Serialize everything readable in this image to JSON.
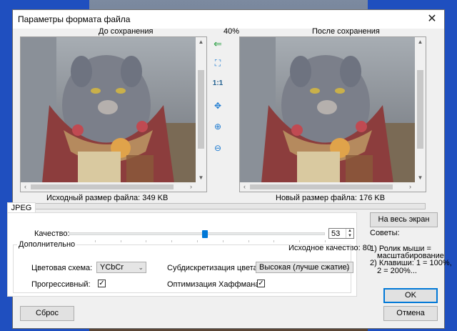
{
  "window": {
    "title": "Параметры формата файла",
    "close_glyph": "✕"
  },
  "zoom_label": "40%",
  "panes": {
    "before_caption": "До сохранения",
    "after_caption": "После сохранения"
  },
  "sizes": {
    "original": "Исходный размер файла:  349 KB",
    "new": "Новый размер файла:  176 KB"
  },
  "toolbar": [
    {
      "name": "back-arrow-icon",
      "glyph": "⇐"
    },
    {
      "name": "fit-window-icon",
      "glyph": "⛶"
    },
    {
      "name": "actual-size-icon",
      "glyph": "1:1"
    },
    {
      "name": "center-icon",
      "glyph": "✥"
    },
    {
      "name": "zoom-in-icon",
      "glyph": "⊕"
    },
    {
      "name": "zoom-out-icon",
      "glyph": "⊖"
    }
  ],
  "tab": {
    "label": "JPEG"
  },
  "quality": {
    "label": "Качество:",
    "value": "53",
    "original_quality": "Исходное качество: 80",
    "fraction": 0.53
  },
  "advanced": {
    "legend": "Дополнительно",
    "color_scheme_label": "Цветовая схема:",
    "color_scheme_value": "YCbCr",
    "subsampling_label": "Субдискретизация цвета:",
    "subsampling_value": "Высокая (лучше сжатие)",
    "progressive_label": "Прогрессивный:",
    "progressive_checked": true,
    "huffman_label": "Оптимизация Хаффмана:",
    "huffman_checked": true
  },
  "buttons": {
    "fullscreen": "На весь экран",
    "ok": "OK",
    "cancel": "Отмена",
    "reset": "Сброс"
  },
  "tips": {
    "title": "Советы:",
    "line1": "1) Ролик мыши =",
    "line2": "масштабирование",
    "line3": "2) Клавиши: 1 = 100%,",
    "line4": "2 = 200%..."
  },
  "colors": {
    "accent": "#0078d7",
    "desktop": "#1f4fbf"
  }
}
